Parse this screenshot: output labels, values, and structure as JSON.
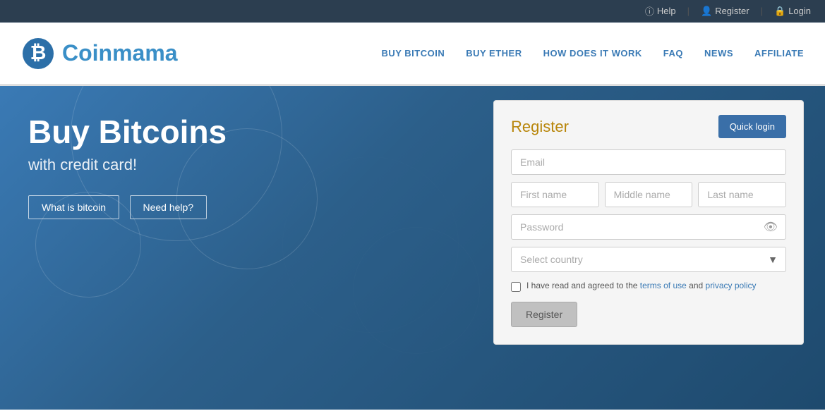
{
  "topbar": {
    "help_label": "Help",
    "register_label": "Register",
    "login_label": "Login"
  },
  "header": {
    "logo_text_first": "Coin",
    "logo_text_second": "mama",
    "nav": [
      {
        "label": "BUY BITCOIN",
        "id": "buy-bitcoin"
      },
      {
        "label": "BUY ETHER",
        "id": "buy-ether"
      },
      {
        "label": "HOW DOES IT WORK",
        "id": "how-it-works"
      },
      {
        "label": "FAQ",
        "id": "faq"
      },
      {
        "label": "NEWS",
        "id": "news"
      },
      {
        "label": "AFFILIATE",
        "id": "affiliate"
      }
    ]
  },
  "hero": {
    "title": "Buy Bitcoins",
    "subtitle": "with credit card!",
    "btn_what": "What is bitcoin",
    "btn_help": "Need help?"
  },
  "register": {
    "title": "Register",
    "quick_login": "Quick login",
    "email_placeholder": "Email",
    "first_name_placeholder": "First name",
    "middle_name_placeholder": "Middle name",
    "last_name_placeholder": "Last name",
    "password_placeholder": "Password",
    "country_placeholder": "Select country",
    "terms_text": "I have read and agreed to the ",
    "terms_of_use": "terms of use",
    "terms_and": " and ",
    "privacy_policy": "privacy policy",
    "register_btn": "Register"
  }
}
